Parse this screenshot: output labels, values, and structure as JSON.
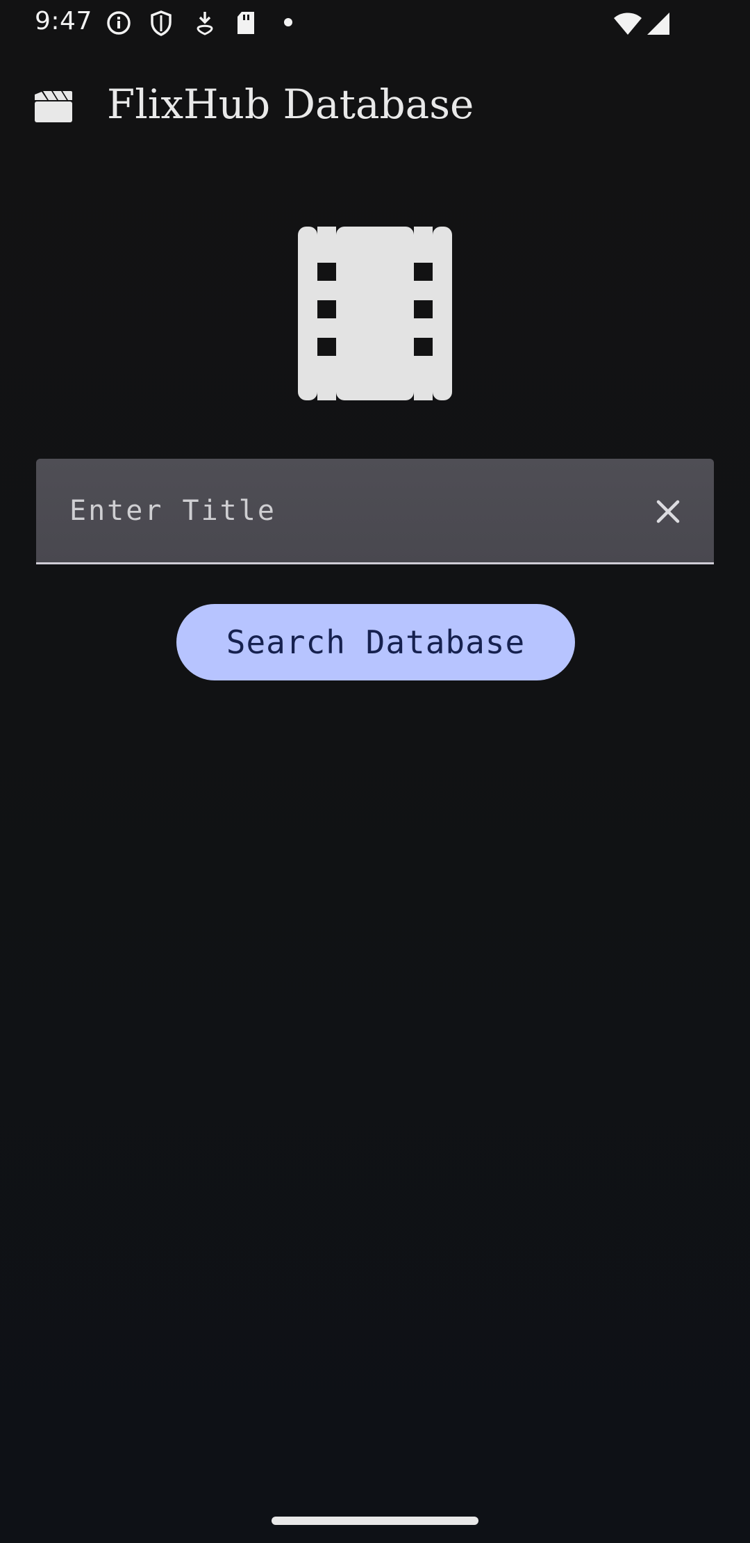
{
  "status_bar": {
    "time": "9:47",
    "left_icons": [
      "info-icon",
      "shield-icon",
      "download-icon",
      "sd-card-icon",
      "notification-dot-icon"
    ],
    "right_icons": [
      "wifi-icon",
      "cellular-signal-icon"
    ]
  },
  "app_bar": {
    "logo_icon": "clapperboard-icon",
    "title": "FlixHub Database"
  },
  "hero": {
    "icon": "film-strip-icon"
  },
  "search": {
    "input_value": "",
    "input_placeholder": "Enter Title",
    "clear_icon": "close-icon",
    "button_label": "Search Database"
  },
  "colors": {
    "background": "#111113",
    "field_background": "#4c4b52",
    "button_background": "#b7c4ff",
    "button_text": "#16214f",
    "icon_light": "#e6e6e6"
  }
}
